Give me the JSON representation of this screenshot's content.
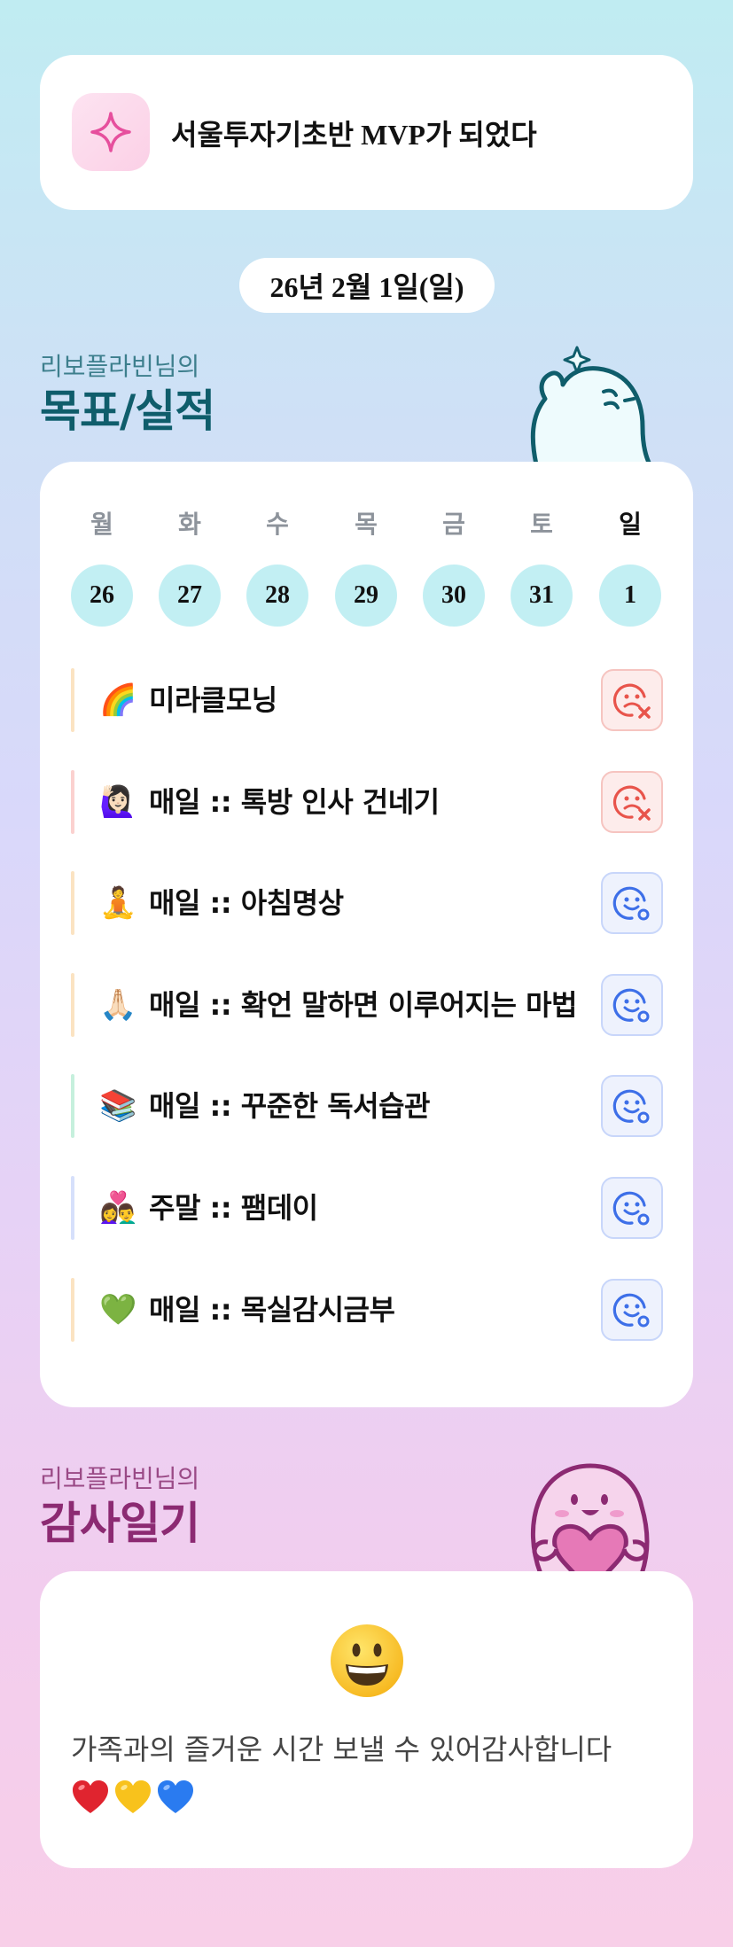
{
  "banner": {
    "icon": "sparkle-icon",
    "text": "서울투자기초반 MVP가 되었다"
  },
  "date": "26년 2월 1일(일)",
  "goals_section": {
    "owner": "리보플라빈님의",
    "title": "목표/실적"
  },
  "week": {
    "days": [
      {
        "label": "월",
        "num": "26"
      },
      {
        "label": "화",
        "num": "27"
      },
      {
        "label": "수",
        "num": "28"
      },
      {
        "label": "목",
        "num": "29"
      },
      {
        "label": "금",
        "num": "30"
      },
      {
        "label": "토",
        "num": "31"
      },
      {
        "label": "일",
        "num": "1"
      }
    ],
    "active_day": "일"
  },
  "goals": [
    {
      "emoji": "🌈",
      "text": "미라클모닝",
      "status": "fail",
      "bar_color": "#fbe3c2"
    },
    {
      "emoji": "🙋🏻‍♀️",
      "text": "매일 :: 톡방 인사 건네기",
      "status": "fail",
      "bar_color": "#fbd1cf"
    },
    {
      "emoji": "🧘",
      "text": "매일 :: 아침명상",
      "status": "done",
      "bar_color": "#fbe3c2"
    },
    {
      "emoji": "🙏🏻",
      "text": "매일 :: 확언 말하면 이루어지는 마법",
      "status": "done",
      "bar_color": "#fbe3c2"
    },
    {
      "emoji": "📚",
      "text": "매일 :: 꾸준한 독서습관",
      "status": "done",
      "bar_color": "#c6f0dd"
    },
    {
      "emoji": "👩‍❤️‍👨",
      "text": "주말 :: 팸데이",
      "status": "done",
      "bar_color": "#d6e0fb"
    },
    {
      "emoji": "💚",
      "text": "매일 :: 목실감시금부",
      "status": "done",
      "bar_color": "#fbe3c2"
    }
  ],
  "thanks_section": {
    "owner": "리보플라빈님의",
    "title": "감사일기"
  },
  "thanks": {
    "mood_icon": "grinning-face-icon",
    "text": "가족과의 즐거운 시간 보낼 수 있어감사합니다",
    "hearts": [
      "red-heart-icon",
      "yellow-heart-icon",
      "blue-heart-icon"
    ]
  },
  "colors": {
    "fail": "#e8544b",
    "done": "#3d6fe8",
    "day_circle": "#c2eff3",
    "goals_title": "#0f5d6b",
    "thanks_title": "#8c2a72"
  }
}
